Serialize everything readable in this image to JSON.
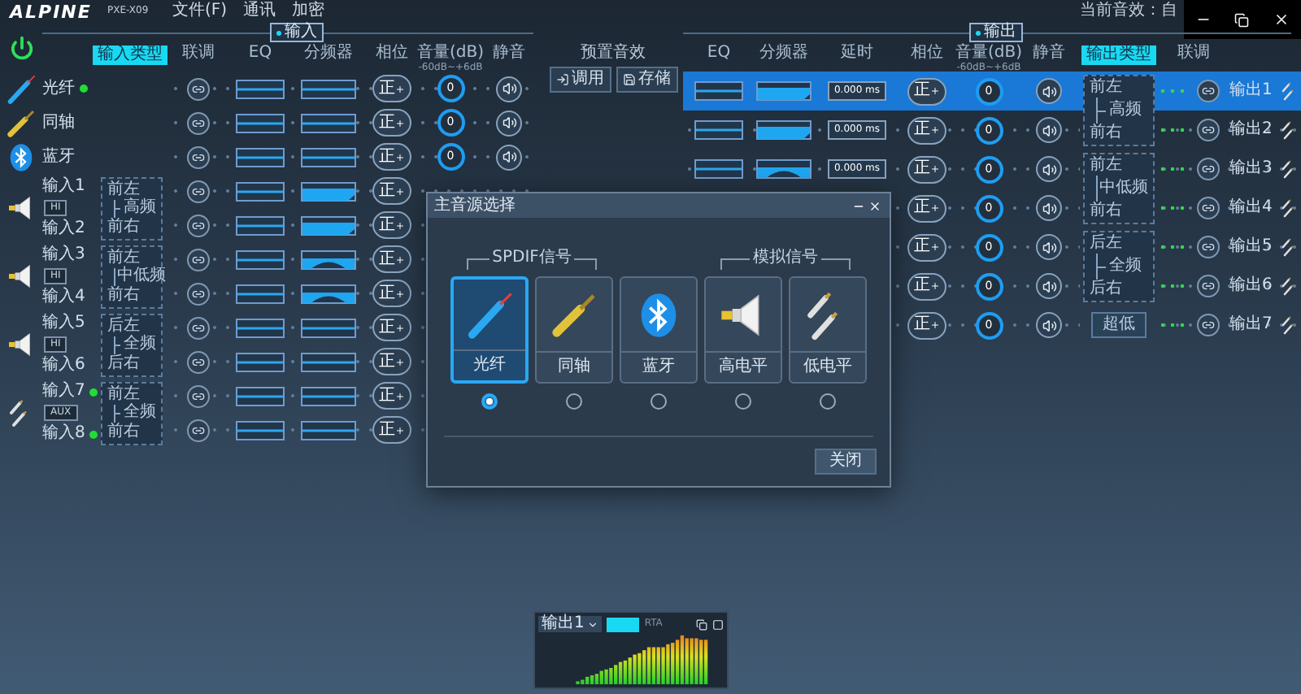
{
  "app": {
    "logo": "ALPINE",
    "model": "PXE-X09",
    "menu": [
      "文件(F)",
      "通讯",
      "加密"
    ],
    "current_preset": "当前音效：自"
  },
  "input_panel": {
    "section": "输入",
    "columns": [
      {
        "label": "输入类型",
        "selected": true
      },
      {
        "label": "联调",
        "selected": false
      },
      {
        "label": "EQ",
        "selected": false
      },
      {
        "label": "分频器",
        "selected": false
      },
      {
        "label": "相位",
        "selected": false
      },
      {
        "label": "音量(dB)",
        "range": "-60dB~+6dB",
        "selected": false
      },
      {
        "label": "静音",
        "selected": false
      }
    ],
    "groups": [
      {
        "kind": "fiber",
        "channels": [
          {
            "name": "光纤",
            "connected": true,
            "kind": "flat",
            "phase": "正",
            "volume": "0"
          }
        ]
      },
      {
        "kind": "coax",
        "channels": [
          {
            "name": "同轴",
            "connected": false,
            "kind": "flat",
            "phase": "正",
            "volume": "0"
          }
        ]
      },
      {
        "kind": "bluetooth",
        "channels": [
          {
            "name": "蓝牙",
            "connected": false,
            "kind": "flat",
            "phase": "正",
            "volume": "0"
          }
        ]
      },
      {
        "kind": "speaker",
        "badge": "HI",
        "route": {
          "top": "前左",
          "middle": "高频",
          "bottom": "前右"
        },
        "channels": [
          {
            "name": "输入1",
            "connected": false,
            "kind": "slope",
            "phase": "正"
          },
          {
            "name": "输入2",
            "connected": false,
            "kind": "slope",
            "phase": "正"
          }
        ]
      },
      {
        "kind": "speaker",
        "badge": "HI",
        "route": {
          "top": "前左",
          "middle": "中低频",
          "bottom": "前右"
        },
        "channels": [
          {
            "name": "输入3",
            "connected": false,
            "kind": "arc",
            "phase": "正"
          },
          {
            "name": "输入4",
            "connected": false,
            "kind": "arc",
            "phase": "正"
          }
        ]
      },
      {
        "kind": "speaker",
        "badge": "HI",
        "route": {
          "top": "后左",
          "middle": "全频",
          "bottom": "后右"
        },
        "channels": [
          {
            "name": "输入5",
            "connected": false,
            "kind": "flat",
            "phase": "正"
          },
          {
            "name": "输入6",
            "connected": false,
            "kind": "flat",
            "phase": "正"
          }
        ]
      },
      {
        "kind": "rca",
        "badge": "AUX",
        "route": {
          "top": "前左",
          "middle": "全频",
          "bottom": "前右"
        },
        "channels": [
          {
            "name": "输入7",
            "connected": true,
            "kind": "flat",
            "phase": "正"
          },
          {
            "name": "输入8",
            "connected": true,
            "kind": "flat",
            "phase": "正"
          }
        ]
      }
    ]
  },
  "presets": {
    "title": "预置音效",
    "buttons": [
      {
        "label": "调用",
        "kind": "load"
      },
      {
        "label": "存储",
        "kind": "save"
      }
    ]
  },
  "output_panel": {
    "section": "输出",
    "columns": [
      {
        "label": "EQ",
        "selected": false
      },
      {
        "label": "分频器",
        "selected": false
      },
      {
        "label": "延时",
        "selected": false
      },
      {
        "label": "相位",
        "selected": false
      },
      {
        "label": "音量(dB)",
        "range": "-60dB~+6dB",
        "selected": false
      },
      {
        "label": "静音",
        "selected": false
      },
      {
        "label": "输出类型",
        "selected": true
      },
      {
        "label": "联调",
        "selected": false
      }
    ],
    "groups": [
      {
        "route": {
          "top": "前左",
          "middle": "高频",
          "bottom": "前右"
        },
        "channels": [
          {
            "name": "输出1",
            "selected": true,
            "kind": "slope",
            "delay": "0.000 ms",
            "phase": "正",
            "volume": "0"
          },
          {
            "name": "输出2",
            "selected": false,
            "kind": "slope",
            "delay": "0.000 ms",
            "phase": "正",
            "volume": "0"
          }
        ]
      },
      {
        "route": {
          "top": "前左",
          "middle": "中低频",
          "bottom": "前右"
        },
        "channels": [
          {
            "name": "输出3",
            "selected": false,
            "kind": "arc",
            "delay": "0.000 ms",
            "phase": "正",
            "volume": "0"
          },
          {
            "name": "输出4",
            "selected": false,
            "phase": "正",
            "volume": "0"
          }
        ]
      },
      {
        "route": {
          "top": "后左",
          "middle": "全频",
          "bottom": "后右"
        },
        "channels": [
          {
            "name": "输出5",
            "selected": false,
            "phase": "正",
            "volume": "0"
          },
          {
            "name": "输出6",
            "selected": false,
            "phase": "正",
            "volume": "0"
          }
        ]
      },
      {
        "label": "超低",
        "channels": [
          {
            "name": "输出7",
            "selected": false,
            "phase": "正",
            "volume": "0"
          }
        ]
      }
    ]
  },
  "dialog": {
    "title": "主音源选择",
    "groups": [
      "SPDIF信号",
      "模拟信号"
    ],
    "sources": [
      {
        "label": "光纤",
        "kind": "fiber",
        "selected": true
      },
      {
        "label": "同轴",
        "kind": "coax",
        "selected": false
      },
      {
        "label": "蓝牙",
        "kind": "bluetooth",
        "selected": false
      },
      {
        "label": "高电平",
        "kind": "speaker",
        "selected": false
      },
      {
        "label": "低电平",
        "kind": "rca",
        "selected": false
      }
    ],
    "close_button": "关闭"
  },
  "rta": {
    "channel": "输出1",
    "toggle_on": true,
    "mode": "RTA"
  }
}
